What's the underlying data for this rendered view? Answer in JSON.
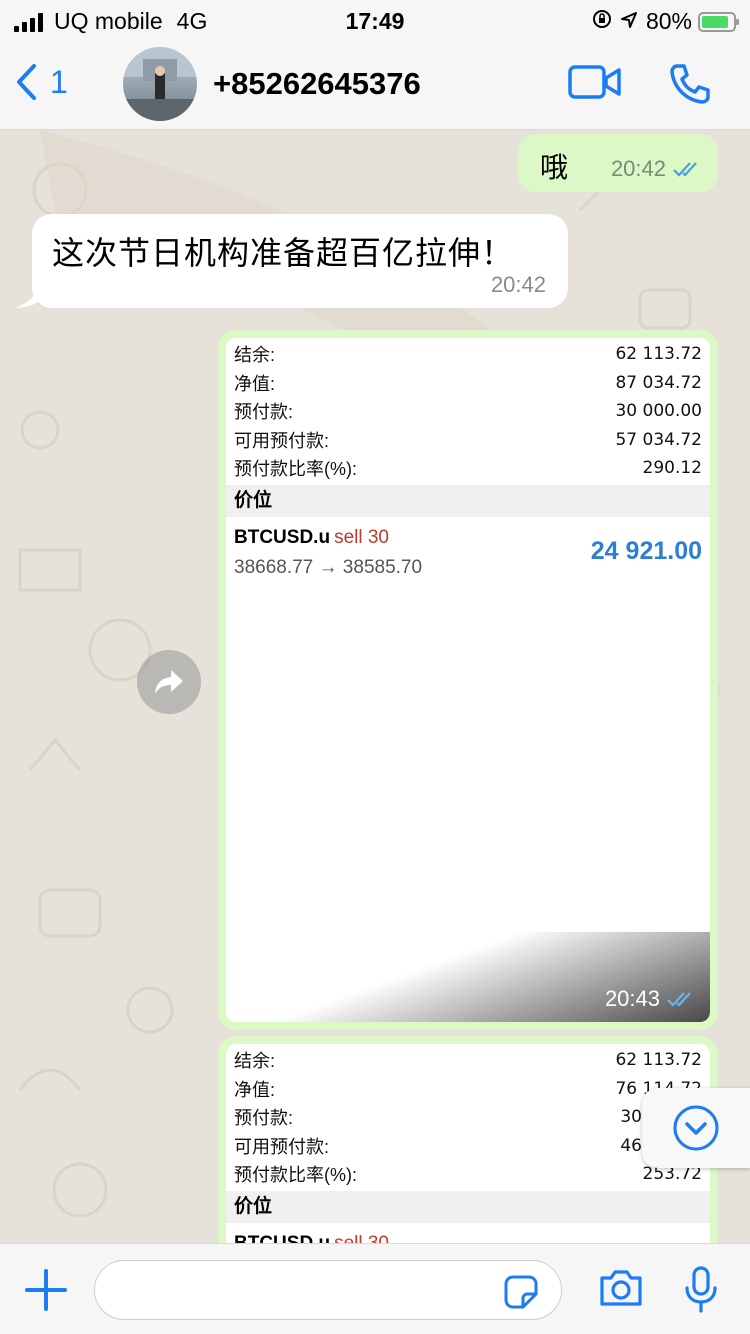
{
  "status_bar": {
    "carrier": "UQ mobile",
    "network": "4G",
    "time": "17:49",
    "battery": "80%"
  },
  "header": {
    "back_count": "1",
    "contact_name": "+85262645376"
  },
  "messages": {
    "outgoing": {
      "text": "哦",
      "time": "20:42"
    },
    "incoming": {
      "text": "这次节日机构准备超百亿拉伸！",
      "time": "20:42"
    },
    "image1": {
      "rows": [
        {
          "label": "结余:",
          "value": "62 113.72"
        },
        {
          "label": "净值:",
          "value": "87 034.72"
        },
        {
          "label": "预付款:",
          "value": "30 000.00"
        },
        {
          "label": "可用预付款:",
          "value": "57 034.72"
        },
        {
          "label": "预付款比率(%):",
          "value": "290.12"
        }
      ],
      "section": "价位",
      "position": {
        "symbol": "BTCUSD.u",
        "side": "sell 30",
        "prices": "38668.77 → 38585.70",
        "profit": "24 921.00"
      },
      "time": "20:43"
    },
    "image2": {
      "rows": [
        {
          "label": "结余:",
          "value": "62 113.72"
        },
        {
          "label": "净值:",
          "value": "76 114.72"
        },
        {
          "label": "预付款:",
          "value": "30"
        },
        {
          "label": "可用预付款:",
          "value": "46"
        },
        {
          "label": "预付款比率(%):",
          "value": "253.72"
        }
      ],
      "section": "价位",
      "position": {
        "symbol": "BTCUSD.u",
        "side": "sell 30"
      }
    }
  },
  "input": {
    "placeholder": ""
  },
  "colors": {
    "accent": "#1c7cf4",
    "outgoing_bubble": "#dcf8c6",
    "profit": "#2c7fd6",
    "sell": "#c0392b"
  },
  "icons": [
    "signal-icon",
    "orientation-lock-icon",
    "location-icon",
    "battery-icon",
    "back-chevron-icon",
    "video-call-icon",
    "phone-icon",
    "read-receipt-icon",
    "forward-icon",
    "chevron-down-icon",
    "plus-icon",
    "sticker-icon",
    "camera-icon",
    "microphone-icon"
  ]
}
